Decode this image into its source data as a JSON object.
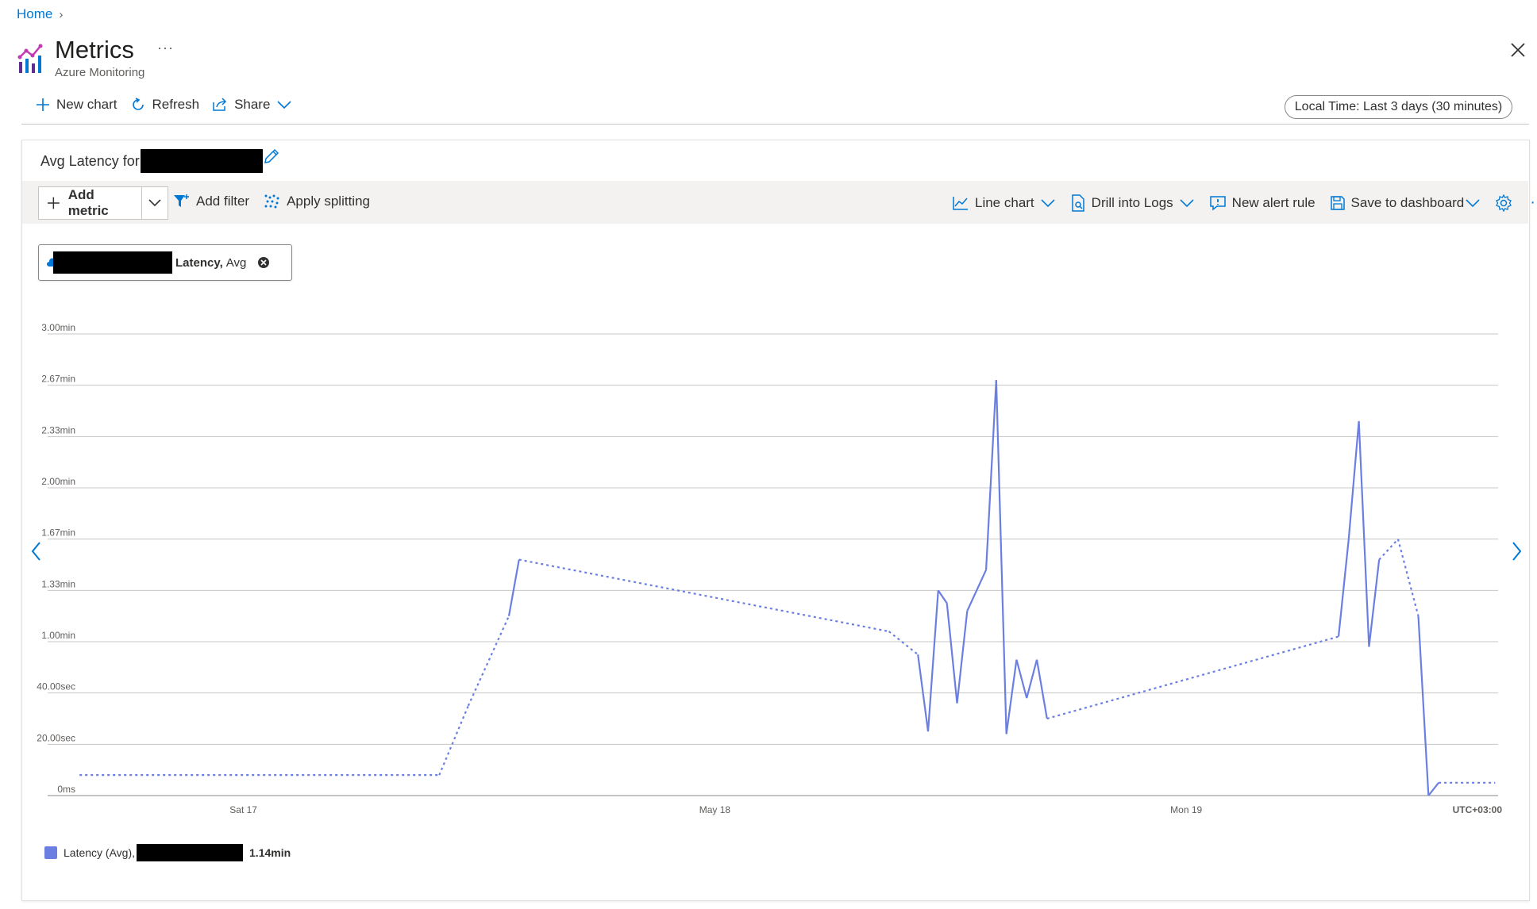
{
  "breadcrumb": {
    "home": "Home"
  },
  "header": {
    "title": "Metrics",
    "subtitle": "Azure Monitoring",
    "more": "···"
  },
  "toolbar": {
    "new_chart": "New chart",
    "refresh": "Refresh",
    "share": "Share",
    "time_range": "Local Time: Last 3 days (30 minutes)"
  },
  "card": {
    "title_prefix": "Avg Latency for"
  },
  "chart_toolbar": {
    "add_metric": "Add metric",
    "add_filter": "Add filter",
    "apply_splitting": "Apply splitting",
    "line_chart": "Line chart",
    "drill_into_logs": "Drill into Logs",
    "new_alert_rule": "New alert rule",
    "save_to_dashboard": "Save to dashboard"
  },
  "metric_pill": {
    "metric": "Latency,",
    "aggregation": "Avg"
  },
  "legend": {
    "label": "Latency (Avg),",
    "value": "1.14min"
  },
  "colors": {
    "accent": "#0078d4",
    "series": "#6b7fe0"
  },
  "chart_data": {
    "type": "line",
    "y_ticks": [
      "3.00min",
      "2.67min",
      "2.33min",
      "2.00min",
      "1.67min",
      "1.33min",
      "1.00min",
      "40.00sec",
      "20.00sec",
      "0ms"
    ],
    "ylim_seconds": [
      0,
      180
    ],
    "x_ticks": [
      {
        "label": "Sat 17",
        "t": 0.135
      },
      {
        "label": "May 18",
        "t": 0.46
      },
      {
        "label": "Mon 19",
        "t": 0.785
      }
    ],
    "timezone": "UTC+03:00",
    "series": [
      {
        "values": [
          {
            "t": 0.022,
            "v": 8,
            "dash": false
          },
          {
            "t": 0.27,
            "v": 8,
            "dash": true
          },
          {
            "t": 0.29,
            "v": 35,
            "dash": true
          },
          {
            "t": 0.318,
            "v": 70,
            "dash": true
          },
          {
            "t": 0.325,
            "v": 92,
            "dash": false
          },
          {
            "t": 0.58,
            "v": 64,
            "dash": true
          },
          {
            "t": 0.6,
            "v": 55,
            "dash": true
          },
          {
            "t": 0.607,
            "v": 25,
            "dash": false
          },
          {
            "t": 0.614,
            "v": 80,
            "dash": false
          },
          {
            "t": 0.62,
            "v": 75,
            "dash": false
          },
          {
            "t": 0.627,
            "v": 36,
            "dash": false
          },
          {
            "t": 0.634,
            "v": 72,
            "dash": false
          },
          {
            "t": 0.647,
            "v": 88,
            "dash": false
          },
          {
            "t": 0.654,
            "v": 162,
            "dash": false
          },
          {
            "t": 0.661,
            "v": 24,
            "dash": false
          },
          {
            "t": 0.668,
            "v": 53,
            "dash": false
          },
          {
            "t": 0.675,
            "v": 38,
            "dash": false
          },
          {
            "t": 0.682,
            "v": 53,
            "dash": false
          },
          {
            "t": 0.689,
            "v": 30,
            "dash": false
          },
          {
            "t": 0.89,
            "v": 62,
            "dash": true
          },
          {
            "t": 0.897,
            "v": 100,
            "dash": false
          },
          {
            "t": 0.904,
            "v": 146,
            "dash": false
          },
          {
            "t": 0.911,
            "v": 58,
            "dash": false
          },
          {
            "t": 0.918,
            "v": 92,
            "dash": false
          },
          {
            "t": 0.931,
            "v": 100,
            "dash": true
          },
          {
            "t": 0.945,
            "v": 70,
            "dash": true
          },
          {
            "t": 0.952,
            "v": 0,
            "dash": false
          },
          {
            "t": 0.959,
            "v": 5,
            "dash": false
          },
          {
            "t": 0.998,
            "v": 5,
            "dash": true
          }
        ]
      }
    ]
  }
}
